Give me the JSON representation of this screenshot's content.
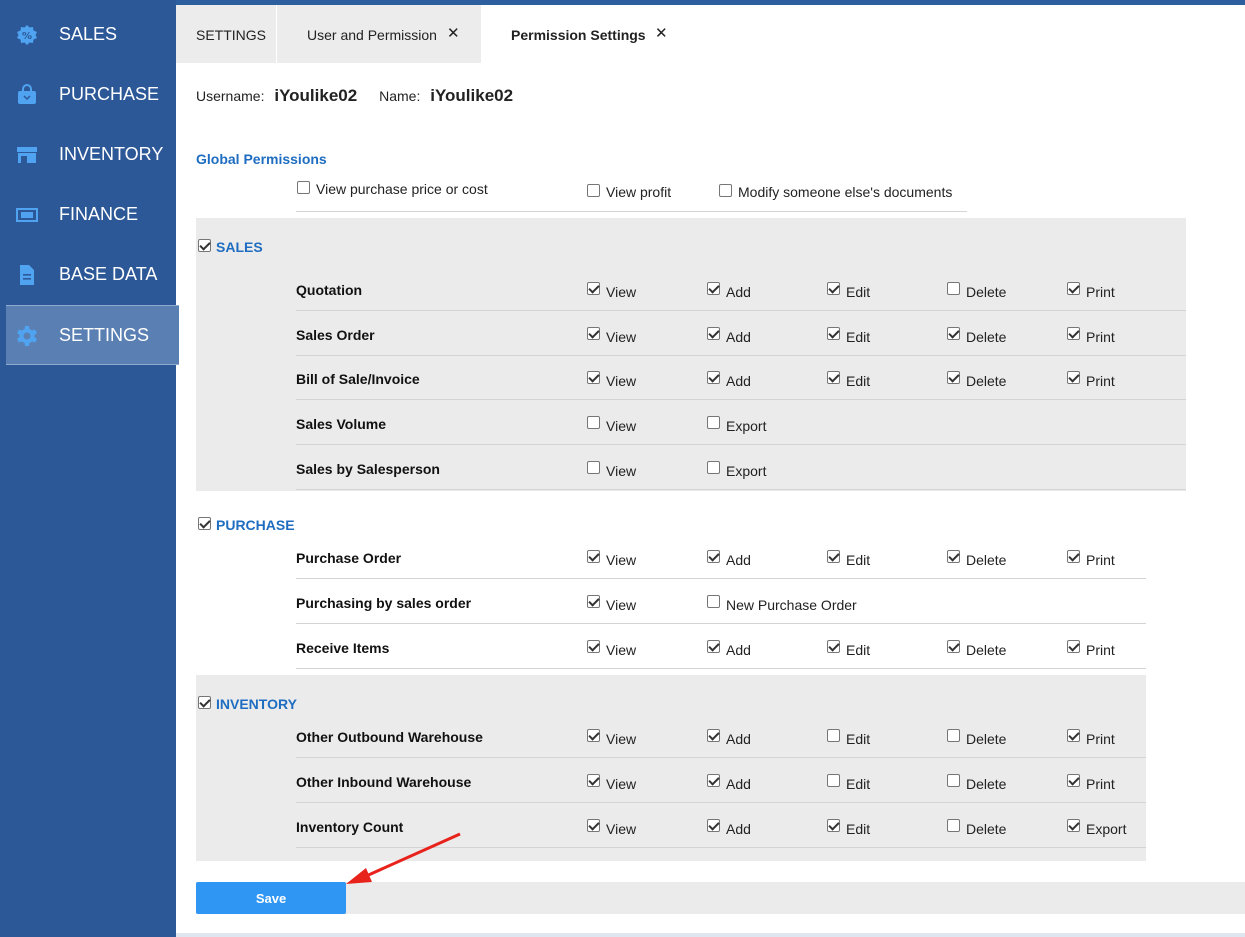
{
  "sidebar": {
    "items": [
      {
        "label": "SALES",
        "icon": "sales-icon"
      },
      {
        "label": "PURCHASE",
        "icon": "bag-icon"
      },
      {
        "label": "INVENTORY",
        "icon": "store-icon"
      },
      {
        "label": "FINANCE",
        "icon": "money-icon"
      },
      {
        "label": "BASE DATA",
        "icon": "document-icon"
      },
      {
        "label": "SETTINGS",
        "icon": "gear-icon",
        "active": true
      }
    ]
  },
  "tabs": [
    {
      "label": "SETTINGS"
    },
    {
      "label": "User and Permission",
      "close": "✕"
    },
    {
      "label": "Permission Settings",
      "close": "✕",
      "active": true
    }
  ],
  "user": {
    "username_label": "Username:",
    "username": "iYoulike02",
    "name_label": "Name:",
    "name": "iYoulike02"
  },
  "global": {
    "title": "Global Permissions",
    "options": [
      {
        "label": "View purchase price or cost",
        "checked": false
      },
      {
        "label": "View profit",
        "checked": false
      },
      {
        "label": "Modify someone else's documents",
        "checked": false
      }
    ]
  },
  "sections": {
    "sales": {
      "title": "SALES",
      "checked": true,
      "rows": [
        {
          "label": "Quotation",
          "perms": [
            [
              "View",
              true
            ],
            [
              "Add",
              true
            ],
            [
              "Edit",
              true
            ],
            [
              "Delete",
              false
            ],
            [
              "Print",
              true
            ]
          ]
        },
        {
          "label": "Sales Order",
          "perms": [
            [
              "View",
              true
            ],
            [
              "Add",
              true
            ],
            [
              "Edit",
              true
            ],
            [
              "Delete",
              true
            ],
            [
              "Print",
              true
            ]
          ]
        },
        {
          "label": "Bill of Sale/Invoice",
          "perms": [
            [
              "View",
              true
            ],
            [
              "Add",
              true
            ],
            [
              "Edit",
              true
            ],
            [
              "Delete",
              true
            ],
            [
              "Print",
              true
            ]
          ]
        },
        {
          "label": "Sales Volume",
          "perms": [
            [
              "View",
              false
            ],
            [
              "Export",
              false
            ]
          ]
        },
        {
          "label": "Sales by Salesperson",
          "perms": [
            [
              "View",
              false
            ],
            [
              "Export",
              false
            ]
          ]
        }
      ]
    },
    "purchase": {
      "title": "PURCHASE",
      "checked": true,
      "rows": [
        {
          "label": "Purchase Order",
          "perms": [
            [
              "View",
              true
            ],
            [
              "Add",
              true
            ],
            [
              "Edit",
              true
            ],
            [
              "Delete",
              true
            ],
            [
              "Print",
              true
            ]
          ]
        },
        {
          "label": "Purchasing by sales order",
          "perms": [
            [
              "View",
              true
            ],
            [
              "New Purchase Order",
              false
            ]
          ]
        },
        {
          "label": "Receive Items",
          "perms": [
            [
              "View",
              true
            ],
            [
              "Add",
              true
            ],
            [
              "Edit",
              true
            ],
            [
              "Delete",
              true
            ],
            [
              "Print",
              true
            ]
          ]
        }
      ]
    },
    "inventory": {
      "title": "INVENTORY",
      "checked": true,
      "rows": [
        {
          "label": "Other Outbound Warehouse",
          "perms": [
            [
              "View",
              true
            ],
            [
              "Add",
              true
            ],
            [
              "Edit",
              false
            ],
            [
              "Delete",
              false
            ],
            [
              "Print",
              true
            ]
          ]
        },
        {
          "label": "Other Inbound Warehouse",
          "perms": [
            [
              "View",
              true
            ],
            [
              "Add",
              true
            ],
            [
              "Edit",
              false
            ],
            [
              "Delete",
              false
            ],
            [
              "Print",
              true
            ]
          ]
        },
        {
          "label": "Inventory Count",
          "perms": [
            [
              "View",
              true
            ],
            [
              "Add",
              true
            ],
            [
              "Edit",
              true
            ],
            [
              "Delete",
              false
            ],
            [
              "Export",
              true
            ]
          ]
        }
      ]
    }
  },
  "save_label": "Save"
}
